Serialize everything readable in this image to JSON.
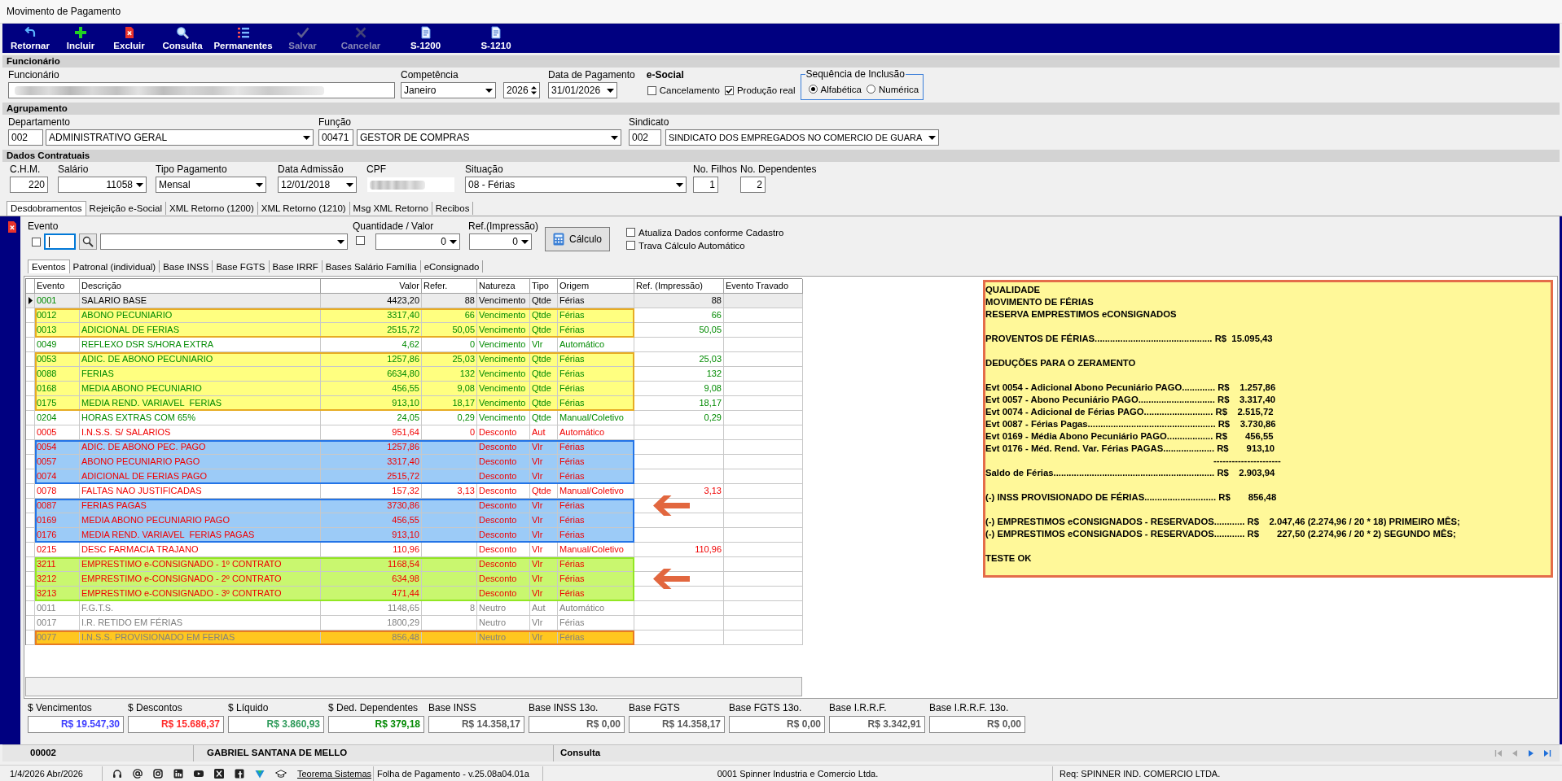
{
  "window": {
    "title": "Movimento de Pagamento"
  },
  "toolbar": [
    {
      "label": "Retornar",
      "kind": "return",
      "disabled": false
    },
    {
      "label": "Incluir",
      "kind": "add",
      "disabled": false
    },
    {
      "label": "Excluir",
      "kind": "delete",
      "disabled": false
    },
    {
      "label": "Consulta",
      "kind": "search",
      "disabled": false
    },
    {
      "label": "Permanentes",
      "kind": "list",
      "disabled": false
    },
    {
      "label": "Salvar",
      "kind": "save",
      "disabled": true
    },
    {
      "label": "Cancelar",
      "kind": "cancel",
      "disabled": true
    },
    {
      "label": "S-1200",
      "kind": "document",
      "disabled": false
    },
    {
      "label": "S-1210",
      "kind": "document",
      "disabled": false
    }
  ],
  "funcionario_section": {
    "title": "Funcionário",
    "funcionario": {
      "label": "Funcionário",
      "redacted": true
    },
    "competencia": {
      "label": "Competência",
      "month": "Janeiro",
      "year": "2026"
    },
    "data_pagamento": {
      "label": "Data de Pagamento",
      "value": "31/01/2026"
    },
    "esocial": {
      "title": "e-Social",
      "options": [
        {
          "label": "Cancelamento",
          "checked": false
        },
        {
          "label": "Produção real",
          "checked": true
        }
      ]
    },
    "sequencia": {
      "title": "Sequência de Inclusão",
      "options": [
        {
          "label": "Alfabética",
          "selected": true
        },
        {
          "label": "Numérica",
          "selected": false
        }
      ]
    }
  },
  "agrupamento": {
    "title": "Agrupamento",
    "fields": [
      {
        "label": "Departamento",
        "code": "002",
        "value": "ADMINISTRATIVO GERAL"
      },
      {
        "label": "Função",
        "code": "00471",
        "value": "GESTOR DE COMPRAS"
      },
      {
        "label": "Sindicato",
        "code": "002",
        "value": "SINDICATO DOS EMPREGADOS NO COMERCIO DE GUARA"
      }
    ]
  },
  "dados_contratuais": {
    "title": "Dados Contratuais",
    "chm": {
      "label": "C.H.M.",
      "value": "220"
    },
    "salario": {
      "label": "Salário",
      "value": "11058"
    },
    "tipo_pagamento": {
      "label": "Tipo Pagamento",
      "value": "Mensal"
    },
    "data_admissao": {
      "label": "Data Admissão",
      "value": "12/01/2018"
    },
    "cpf": {
      "label": "CPF",
      "redacted": true
    },
    "situacao": {
      "label": "Situação",
      "value": "08 - Férias"
    },
    "filhos": {
      "label": "No. Filhos",
      "value": "1"
    },
    "dependentes": {
      "label": "No. Dependentes",
      "value": "2"
    }
  },
  "tabs": [
    {
      "label": "Desdobramentos",
      "selected": true
    },
    {
      "label": "Rejeição e-Social",
      "selected": false
    },
    {
      "label": "XML Retorno (1200)",
      "selected": false
    },
    {
      "label": "XML Retorno (1210)",
      "selected": false
    },
    {
      "label": "Msg XML Retorno",
      "selected": false
    },
    {
      "label": "Recibos",
      "selected": false
    }
  ],
  "evento_panel": {
    "evento": {
      "label": "Evento",
      "checked": false,
      "focused": true
    },
    "quantidade": {
      "label": "Quantidade / Valor",
      "checked": false,
      "value": "0"
    },
    "ref_impressao": {
      "label": "Ref.(Impressão)",
      "value": "0"
    },
    "calc_button": "Cálculo",
    "options": [
      {
        "label": "Atualiza Dados conforme Cadastro",
        "checked": false
      },
      {
        "label": "Trava Cálculo Automático",
        "checked": false
      }
    ]
  },
  "subtabs": [
    {
      "label": "Eventos",
      "selected": true
    },
    {
      "label": "Patronal (individual)",
      "selected": false
    },
    {
      "label": "Base INSS",
      "selected": false
    },
    {
      "label": "Base FGTS",
      "selected": false
    },
    {
      "label": "Base IRRF",
      "selected": false
    },
    {
      "label": "Bases Salário Família",
      "selected": false
    },
    {
      "label": "eConsignado",
      "selected": false
    }
  ],
  "table": {
    "columns": [
      "Evento",
      "Descrição",
      "Valor",
      "Refer.",
      "Natureza",
      "Tipo",
      "Origem",
      "Ref. (Impressão)",
      "Evento Travado"
    ],
    "rows": [
      {
        "evento": "0001",
        "descricao": "SALARIO BASE",
        "valor": "4423,20",
        "refer": "88",
        "natureza": "Vencimento",
        "tipo": "Qtde",
        "origem": "Férias",
        "ref_impressao": "88",
        "kind": "vencimento",
        "selected": true,
        "arrow": false
      },
      {
        "evento": "0012",
        "descricao": "ABONO PECUNIARIO",
        "valor": "3317,40",
        "refer": "66",
        "natureza": "Vencimento",
        "tipo": "Qtde",
        "origem": "Férias",
        "ref_impressao": "66",
        "kind": "vencimento",
        "selected": false,
        "arrow": false,
        "color": "#ffff80"
      },
      {
        "evento": "0013",
        "descricao": "ADICIONAL DE FERIAS",
        "valor": "2515,72",
        "refer": "50,05",
        "natureza": "Vencimento",
        "tipo": "Qtde",
        "origem": "Férias",
        "ref_impressao": "50,05",
        "kind": "vencimento",
        "selected": false,
        "arrow": false,
        "color": "#ffff80"
      },
      {
        "evento": "0049",
        "descricao": "REFLEXO DSR S/HORA EXTRA",
        "valor": "4,62",
        "refer": "0",
        "natureza": "Vencimento",
        "tipo": "Vlr",
        "origem": "Automático",
        "kind": "vencimento",
        "selected": false,
        "arrow": false
      },
      {
        "evento": "0053",
        "descricao": "ADIC. DE ABONO PECUNIARIO",
        "valor": "1257,86",
        "refer": "25,03",
        "natureza": "Vencimento",
        "tipo": "Qtde",
        "origem": "Férias",
        "ref_impressao": "25,03",
        "kind": "vencimento",
        "selected": false,
        "arrow": false,
        "color": "#ffff80"
      },
      {
        "evento": "0088",
        "descricao": "FERIAS",
        "valor": "6634,80",
        "refer": "132",
        "natureza": "Vencimento",
        "tipo": "Qtde",
        "origem": "Férias",
        "ref_impressao": "132",
        "kind": "vencimento",
        "selected": false,
        "arrow": false,
        "color": "#ffff80"
      },
      {
        "evento": "0168",
        "descricao": "MEDIA ABONO PECUNIARIO",
        "valor": "456,55",
        "refer": "9,08",
        "natureza": "Vencimento",
        "tipo": "Qtde",
        "origem": "Férias",
        "ref_impressao": "9,08",
        "kind": "vencimento",
        "selected": false,
        "arrow": false,
        "color": "#ffff80"
      },
      {
        "evento": "0175",
        "descricao": "MEDIA REND. VARIAVEL  FERIAS",
        "valor": "913,10",
        "refer": "18,17",
        "natureza": "Vencimento",
        "tipo": "Qtde",
        "origem": "Férias",
        "ref_impressao": "18,17",
        "kind": "vencimento",
        "selected": false,
        "arrow": false,
        "color": "#ffff80"
      },
      {
        "evento": "0204",
        "descricao": "HORAS EXTRAS COM 65%",
        "valor": "24,05",
        "refer": "0,29",
        "natureza": "Vencimento",
        "tipo": "Qtde",
        "origem": "Manual/Coletivo",
        "ref_impressao": "0,29",
        "kind": "vencimento",
        "selected": false,
        "arrow": false
      },
      {
        "evento": "0005",
        "descricao": "I.N.S.S. S/ SALARIOS",
        "valor": "951,64",
        "refer": "0",
        "natureza": "Desconto",
        "tipo": "Aut",
        "origem": "Automático",
        "kind": "desconto",
        "selected": false,
        "arrow": false
      },
      {
        "evento": "0054",
        "descricao": "ADIC. DE ABONO PEC. PAGO",
        "valor": "1257,86",
        "natureza": "Desconto",
        "tipo": "Vlr",
        "origem": "Férias",
        "kind": "desconto",
        "selected": false,
        "arrow": false,
        "color": "#9ccbf7"
      },
      {
        "evento": "0057",
        "descricao": "ABONO PECUNIARIO PAGO",
        "valor": "3317,40",
        "natureza": "Desconto",
        "tipo": "Vlr",
        "origem": "Férias",
        "kind": "desconto",
        "selected": false,
        "arrow": false,
        "color": "#9ccbf7"
      },
      {
        "evento": "0074",
        "descricao": "ADICIONAL DE FERIAS PAGO",
        "valor": "2515,72",
        "natureza": "Desconto",
        "tipo": "Vlr",
        "origem": "Férias",
        "kind": "desconto",
        "selected": false,
        "arrow": false,
        "color": "#9ccbf7"
      },
      {
        "evento": "0078",
        "descricao": "FALTAS NAO JUSTIFICADAS",
        "valor": "157,32",
        "refer": "3,13",
        "natureza": "Desconto",
        "tipo": "Qtde",
        "origem": "Manual/Coletivo",
        "ref_impressao": "3,13",
        "kind": "desconto",
        "selected": false,
        "arrow": false
      },
      {
        "evento": "0087",
        "descricao": "FERIAS PAGAS",
        "valor": "3730,86",
        "natureza": "Desconto",
        "tipo": "Vlr",
        "origem": "Férias",
        "kind": "desconto",
        "selected": false,
        "arrow": true,
        "color": "#9ccbf7"
      },
      {
        "evento": "0169",
        "descricao": "MEDIA ABONO PECUNIARIO PAGO",
        "valor": "456,55",
        "natureza": "Desconto",
        "tipo": "Vlr",
        "origem": "Férias",
        "kind": "desconto",
        "selected": false,
        "arrow": false,
        "color": "#9ccbf7"
      },
      {
        "evento": "0176",
        "descricao": "MEDIA REND. VARIAVEL  FERIAS PAGAS",
        "valor": "913,10",
        "natureza": "Desconto",
        "tipo": "Vlr",
        "origem": "Férias",
        "kind": "desconto",
        "selected": false,
        "arrow": false,
        "color": "#9ccbf7"
      },
      {
        "evento": "0215",
        "descricao": "DESC FARMACIA TRAJANO",
        "valor": "110,96",
        "natureza": "Desconto",
        "tipo": "Vlr",
        "origem": "Manual/Coletivo",
        "ref_impressao": "110,96",
        "kind": "desconto",
        "selected": false,
        "arrow": false
      },
      {
        "evento": "3211",
        "descricao": "EMPRESTIMO e-CONSIGNADO - 1º CONTRATO",
        "valor": "1168,54",
        "natureza": "Desconto",
        "tipo": "Vlr",
        "origem": "Férias",
        "kind": "desconto",
        "selected": false,
        "arrow": false,
        "color": "#c9f76f"
      },
      {
        "evento": "3212",
        "descricao": "EMPRESTIMO e-CONSIGNADO - 2º CONTRATO",
        "valor": "634,98",
        "natureza": "Desconto",
        "tipo": "Vlr",
        "origem": "Férias",
        "kind": "desconto",
        "selected": false,
        "arrow": true,
        "color": "#c9f76f"
      },
      {
        "evento": "3213",
        "descricao": "EMPRESTIMO e-CONSIGNADO - 3º CONTRATO",
        "valor": "471,44",
        "natureza": "Desconto",
        "tipo": "Vlr",
        "origem": "Férias",
        "kind": "desconto",
        "selected": false,
        "arrow": false,
        "color": "#c9f76f"
      },
      {
        "evento": "0011",
        "descricao": "F.G.T.S.",
        "valor": "1148,65",
        "refer": "8",
        "natureza": "Neutro",
        "tipo": "Aut",
        "origem": "Automático",
        "kind": "neutro",
        "selected": false,
        "arrow": false
      },
      {
        "evento": "0017",
        "descricao": "I.R. RETIDO EM FÉRIAS",
        "valor": "1800,29",
        "natureza": "Neutro",
        "tipo": "Vlr",
        "origem": "Férias",
        "kind": "neutro",
        "selected": false,
        "arrow": false
      },
      {
        "evento": "0077",
        "descricao": "I.N.S.S. PROVISIONADO EM FERIAS",
        "valor": "856,48",
        "natureza": "Neutro",
        "tipo": "Vlr",
        "origem": "Férias",
        "kind": "neutro",
        "selected": false,
        "arrow": false,
        "color": "#ffc71f"
      }
    ]
  },
  "note": {
    "paragraphs": [
      {
        "lines": [
          "QUALIDADE",
          "MOVIMENTO DE FÉRIAS",
          "RESERVA EMPRESTIMOS eCONSIGNADOS"
        ]
      },
      {
        "lines": [
          "PROVENTOS DE FÉRIAS.............................................. R$  15.095,43"
        ]
      },
      {
        "lines": [
          "DEDUÇÕES PARA O ZERAMENTO"
        ]
      },
      {
        "lines": [
          "Evt 0054 - Adicional Abono Pecuniário PAGO............. R$    1.257,86",
          "Evt 0057 - Abono Pecuniário PAGO.............................. R$    3.317,40",
          "Evt 0074 - Adicional de Férias PAGO........................... R$    2.515,72",
          "Evt 0087 - Férias Pagas.................................................. R$    3.730,86",
          "Evt 0169 - Média Abono Pecuniário PAGO.................. R$       456,55",
          "Evt 0176 - Méd. Rend. Var. Férias PAGAS.................... R$       913,10"
        ],
        "rule": "----------------------",
        "total": "Saldo de Férias............................................................... R$    2.903,94"
      },
      {
        "lines": [
          "(-) INSS PROVISIONADO DE FÉRIAS............................ R$       856,48"
        ]
      },
      {
        "lines": [
          "(-) EMPRESTIMOS eCONSIGNADOS - RESERVADOS............ R$    2.047,46 (2.274,96 / 20 * 18) PRIMEIRO MÊS;",
          "(-) EMPRESTIMOS eCONSIGNADOS - RESERVADOS............ R$       227,50 (2.274,96 / 20 * 2) SEGUNDO MÊS;"
        ]
      },
      {
        "lines": [
          "TESTE OK"
        ]
      }
    ]
  },
  "totals": [
    {
      "label": "$ Vencimentos",
      "value": "R$ 19.547,30",
      "color": "#3d3dff"
    },
    {
      "label": "$ Descontos",
      "value": "R$ 15.686,37",
      "color": "#ff2b2b"
    },
    {
      "label": "$ Líquido",
      "value": "R$ 3.860,93",
      "color": "#2e9a5a"
    },
    {
      "label": "$ Ded. Dependentes",
      "value": "R$ 379,18",
      "color": "#058a05"
    },
    {
      "label": "Base INSS",
      "value": "R$ 14.358,17",
      "color": "#5a5a5a"
    },
    {
      "label": "Base INSS 13o.",
      "value": "R$ 0,00",
      "color": "#5a5a5a"
    },
    {
      "label": "Base FGTS",
      "value": "R$ 14.358,17",
      "color": "#5a5a5a"
    },
    {
      "label": "Base FGTS 13o.",
      "value": "R$ 0,00",
      "color": "#5a5a5a"
    },
    {
      "label": "Base I.R.R.F.",
      "value": "R$ 3.342,91",
      "color": "#5a5a5a"
    },
    {
      "label": "Base I.R.R.F. 13o.",
      "value": "R$ 0,00",
      "color": "#5a5a5a"
    }
  ],
  "status_bar": {
    "code": "00002",
    "name": "GABRIEL SANTANA DE MELLO",
    "mode": "Consulta",
    "nav": [
      {
        "kind": "first",
        "disabled": true
      },
      {
        "kind": "previous",
        "disabled": true
      },
      {
        "kind": "next",
        "disabled": false
      },
      {
        "kind": "last",
        "disabled": false
      }
    ]
  },
  "footer": {
    "date": "1/4/2026 Abr/2026",
    "link": "Teorema Sistemas",
    "version": "Folha de Pagamento - v.25.08a04.01a",
    "company": "0001 Spinner Industria e Comercio Ltda.",
    "request": "Req: SPINNER IND. COMERCIO LTDA."
  }
}
